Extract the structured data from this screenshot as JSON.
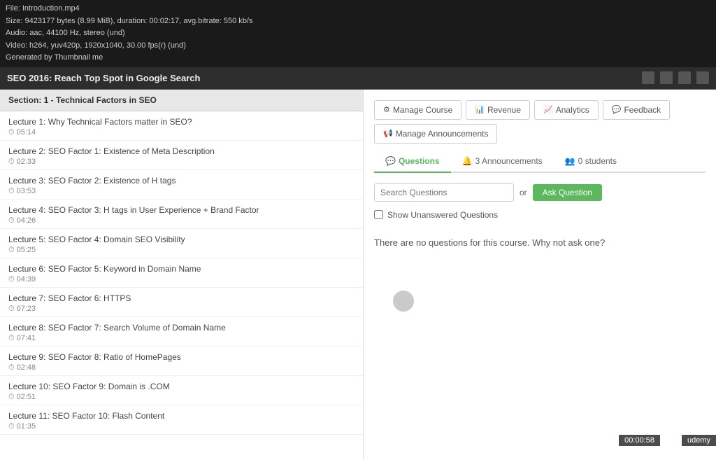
{
  "infoBar": {
    "line1": "File: Introduction.mp4",
    "line2": "Size: 9423177 bytes (8.99 MiB), duration: 00:02:17, avg.bitrate: 550 kb/s",
    "line3": "Audio: aac, 44100 Hz, stereo (und)",
    "line4": "Video: h264, yuv420p, 1920x1040, 30.00 fps(r) (und)",
    "line5": "Generated by Thumbnail me"
  },
  "navBar": {
    "title": "SEO 2016: Reach Top Spot in Google Search"
  },
  "sidebar": {
    "sectionHeader": "Section: 1 - Technical Factors in SEO",
    "lectures": [
      {
        "title": "Lecture 1: Why Technical Factors matter in SEO?",
        "duration": "05:14"
      },
      {
        "title": "Lecture 2: SEO Factor 1: Existence of Meta Description",
        "duration": "02:33"
      },
      {
        "title": "Lecture 3: SEO Factor 2: Existence of H tags",
        "duration": "03:53"
      },
      {
        "title": "Lecture 4: SEO Factor 3: H tags in User Experience + Brand Factor",
        "duration": "04:26"
      },
      {
        "title": "Lecture 5: SEO Factor 4: Domain SEO Visibility",
        "duration": "05:25"
      },
      {
        "title": "Lecture 6: SEO Factor 5: Keyword in Domain Name",
        "duration": "04:39"
      },
      {
        "title": "Lecture 7: SEO Factor 6: HTTPS",
        "duration": "07:23"
      },
      {
        "title": "Lecture 8: SEO Factor 7: Search Volume of Domain Name",
        "duration": "07:41"
      },
      {
        "title": "Lecture 9: SEO Factor 8: Ratio of HomePages",
        "duration": "02:48"
      },
      {
        "title": "Lecture 10: SEO Factor 9: Domain is .COM",
        "duration": "02:51"
      },
      {
        "title": "Lecture 11: SEO Factor 10: Flash Content",
        "duration": "01:35"
      }
    ]
  },
  "toolbar": {
    "manageCourseLabel": "Manage Course",
    "revenueLabel": "Revenue",
    "analyticsLabel": "Analytics",
    "feedbackLabel": "Feedback",
    "manageAnnouncementsLabel": "Manage Announcements"
  },
  "tabs": {
    "questionsLabel": "Questions",
    "announcementsLabel": "3 Announcements",
    "studentsLabel": "0 students"
  },
  "questions": {
    "searchPlaceholder": "Search Questions",
    "orText": "or",
    "askButtonLabel": "Ask Question",
    "checkboxLabel": "Show Unanswered Questions",
    "noQuestionsMessage": "There are no questions for this course. Why not ask one?"
  },
  "footer": {
    "brand": "udemy",
    "timer": "00:00:58"
  }
}
